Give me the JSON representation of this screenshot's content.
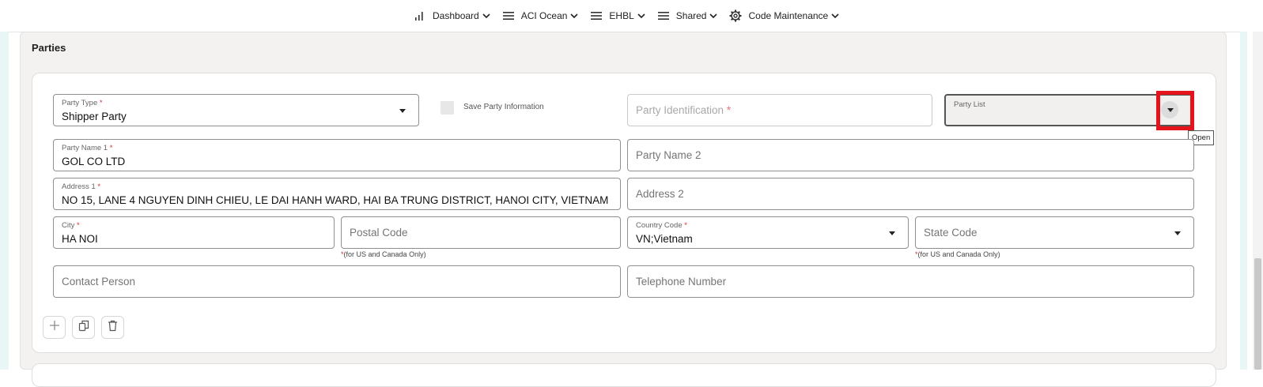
{
  "nav": {
    "items": [
      {
        "label": "Dashboard",
        "icon": "bar-chart-icon"
      },
      {
        "label": "ACI Ocean",
        "icon": "menu-icon"
      },
      {
        "label": "EHBL",
        "icon": "menu-icon"
      },
      {
        "label": "Shared",
        "icon": "menu-icon"
      },
      {
        "label": "Code Maintenance",
        "icon": "gear-icon"
      }
    ]
  },
  "section": {
    "title": "Parties"
  },
  "form": {
    "party_type": {
      "label": "Party Type",
      "required_mark": "*",
      "value": "Shipper Party"
    },
    "save_party": {
      "label": "Save Party Information",
      "checked": false
    },
    "party_identification": {
      "placeholder": "Party Identification",
      "required_mark": "*"
    },
    "party_list": {
      "label": "Party List",
      "open_tooltip": "Open"
    },
    "party_name_1": {
      "label": "Party Name 1",
      "required_mark": "*",
      "value": "GOL CO LTD"
    },
    "party_name_2": {
      "placeholder": "Party Name 2"
    },
    "address_1": {
      "label": "Address 1",
      "required_mark": "*",
      "value": "NO 15, LANE 4 NGUYEN DINH CHIEU, LE DAI HANH WARD, HAI BA TRUNG DISTRICT, HANOI CITY, VIETNAM"
    },
    "address_2": {
      "placeholder": "Address 2"
    },
    "city": {
      "label": "City",
      "required_mark": "*",
      "value": "HA NOI"
    },
    "postal_code": {
      "placeholder": "Postal Code",
      "hint_mark": "*",
      "hint": "(for US and Canada Only)"
    },
    "country_code": {
      "label": "Country Code",
      "required_mark": "*",
      "value": "VN;Vietnam"
    },
    "state_code": {
      "placeholder": "State Code",
      "hint_mark": "*",
      "hint": "(for US and Canada Only)"
    },
    "contact_person": {
      "placeholder": "Contact Person"
    },
    "telephone": {
      "placeholder": "Telephone Number"
    }
  },
  "actions": [
    {
      "icon": "plus-icon"
    },
    {
      "icon": "copy-icon"
    },
    {
      "icon": "trash-icon"
    }
  ],
  "colors": {
    "required": "#d32f2f",
    "highlight": "#e5141a",
    "accent_strip": "#e8f6f6"
  }
}
